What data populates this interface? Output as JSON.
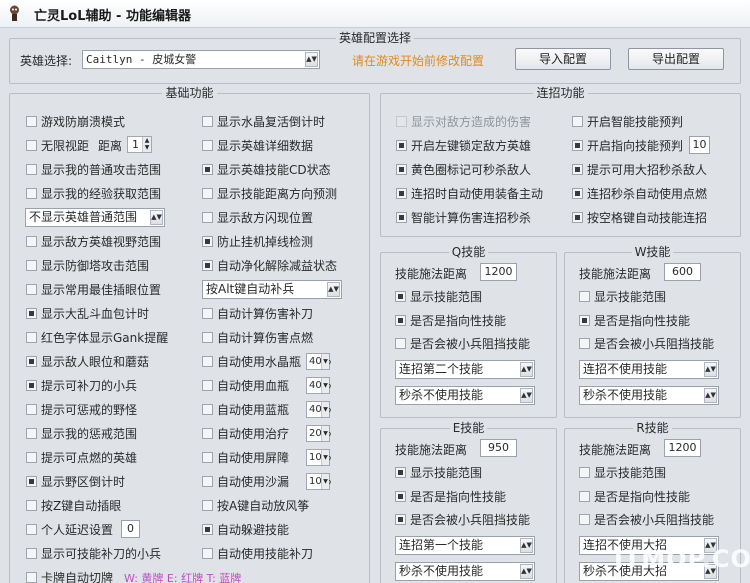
{
  "window": {
    "title": "亡灵LoL辅助 - 功能编辑器"
  },
  "hero_config": {
    "group_title": "英雄配置选择",
    "select_label": "英雄选择:",
    "selected_hero": "Caitlyn - 皮城女警",
    "hint": "请在游戏开始前修改配置",
    "import_label": "导入配置",
    "export_label": "导出配置",
    "hint_color": "#e08a1e"
  },
  "basic": {
    "title": "基础功能",
    "left": [
      {
        "label": "游戏防崩溃模式",
        "checked": false
      },
      {
        "label": "无限视距",
        "checked": false
      },
      {
        "label": "显示我的普通攻击范围",
        "checked": false
      },
      {
        "label": "显示我的经验获取范围",
        "checked": false
      },
      {
        "label": "显示敌方英雄视野范围",
        "checked": false
      },
      {
        "label": "显示防御塔攻击范围",
        "checked": false
      },
      {
        "label": "显示常用最佳插眼位置",
        "checked": false
      },
      {
        "label": "显示大乱斗血包计时",
        "checked": true
      },
      {
        "label": "红色字体显示Gank提醒",
        "checked": false
      },
      {
        "label": "显示敌人眼位和蘑菇",
        "checked": true
      },
      {
        "label": "提示可补刀的小兵",
        "checked": true
      },
      {
        "label": "提示可惩戒的野怪",
        "checked": false
      },
      {
        "label": "显示我的惩戒范围",
        "checked": false
      },
      {
        "label": "提示可点燃的英雄",
        "checked": false
      },
      {
        "label": "显示野区倒计时",
        "checked": true
      },
      {
        "label": "按Z键自动插眼",
        "checked": false
      },
      {
        "label": "个人延迟设置",
        "checked": false
      },
      {
        "label": "显示可技能补刀的小兵",
        "checked": false
      },
      {
        "label": "卡牌自动切牌",
        "checked": false
      }
    ],
    "view_distance_label": "距离",
    "view_distance_value": "1",
    "attack_range_dropdown": "不显示英雄普通范围",
    "latency_value": "0",
    "card_hint": "W: 黄牌 E: 红牌 T: 蓝牌",
    "card_hint_color": "#c04cc4",
    "right": [
      {
        "label": "显示水晶复活倒计时",
        "checked": false
      },
      {
        "label": "显示英雄详细数据",
        "checked": false
      },
      {
        "label": "显示英雄技能CD状态",
        "checked": true
      },
      {
        "label": "显示技能距离方向预测",
        "checked": false
      },
      {
        "label": "显示敌方闪现位置",
        "checked": false
      },
      {
        "label": "防止挂机掉线检测",
        "checked": true
      },
      {
        "label": "自动净化解除减益状态",
        "checked": true
      },
      {
        "label": "自动计算伤害补刀",
        "checked": false
      },
      {
        "label": "自动计算伤害点燃",
        "checked": false
      },
      {
        "label": "自动使用水晶瓶",
        "checked": false
      },
      {
        "label": "自动使用血瓶",
        "checked": false
      },
      {
        "label": "自动使用蓝瓶",
        "checked": false
      },
      {
        "label": "自动使用治疗",
        "checked": false
      },
      {
        "label": "自动使用屏障",
        "checked": false
      },
      {
        "label": "自动使用沙漏",
        "checked": false
      },
      {
        "label": "按A键自动放风筝",
        "checked": false
      },
      {
        "label": "自动躲避技能",
        "checked": true
      },
      {
        "label": "自动使用技能补刀",
        "checked": false
      }
    ],
    "auto_farm_dropdown": "按Alt键自动补兵",
    "crystal_pct": "40%",
    "hp_pct": "40%",
    "mana_pct": "40%",
    "heal_pct": "20%",
    "barrier_pct": "10%",
    "hourglass_pct": "10%"
  },
  "combo": {
    "title": "连招功能",
    "left": [
      {
        "label": "显示对敌方造成的伤害",
        "checked": false,
        "disabled": true
      },
      {
        "label": "开启左键锁定敌方英雄",
        "checked": true
      },
      {
        "label": "黄色圈标记可秒杀敌人",
        "checked": true
      },
      {
        "label": "连招时自动使用装备主动",
        "checked": true
      },
      {
        "label": "智能计算伤害连招秒杀",
        "checked": true
      }
    ],
    "right": [
      {
        "label": "开启智能技能预判",
        "checked": false
      },
      {
        "label": "开启指向技能预判",
        "checked": true
      },
      {
        "label": "提示可用大招秒杀敌人",
        "checked": true
      },
      {
        "label": "连招秒杀自动使用点燃",
        "checked": true
      },
      {
        "label": "按空格键自动技能连招",
        "checked": true
      }
    ],
    "predict_value": "10"
  },
  "skills": [
    {
      "title": "Q技能",
      "range_label": "技能施法距离",
      "range": "1200",
      "show_range": "显示技能范围",
      "show_checked": true,
      "targeted": "是否是指向性技能",
      "targeted_checked": true,
      "blocked": "是否会被小兵阻挡技能",
      "blocked_checked": false,
      "combo_select": "连招第二个技能",
      "kill_select": "秒杀不使用技能"
    },
    {
      "title": "W技能",
      "range_label": "技能施法距离",
      "range": "600",
      "show_range": "显示技能范围",
      "show_checked": false,
      "targeted": "是否是指向性技能",
      "targeted_checked": true,
      "blocked": "是否会被小兵阻挡技能",
      "blocked_checked": false,
      "combo_select": "连招不使用技能",
      "kill_select": "秒杀不使用技能"
    },
    {
      "title": "E技能",
      "range_label": "技能施法距离",
      "range": "950",
      "show_range": "显示技能范围",
      "show_checked": true,
      "targeted": "是否是指向性技能",
      "targeted_checked": true,
      "blocked": "是否会被小兵阻挡技能",
      "blocked_checked": true,
      "combo_select": "连招第一个技能",
      "kill_select": "秒杀不使用技能"
    },
    {
      "title": "R技能",
      "range_label": "技能施法距离",
      "range": "1200",
      "show_range": "显示技能范围",
      "show_checked": false,
      "targeted": "是否是指向性技能",
      "targeted_checked": false,
      "blocked": "是否会被小兵阻挡技能",
      "blocked_checked": false,
      "combo_select": "连招不使用大招",
      "kill_select": "秒杀不使用大招"
    }
  ],
  "watermark": "ITMOP.COM"
}
